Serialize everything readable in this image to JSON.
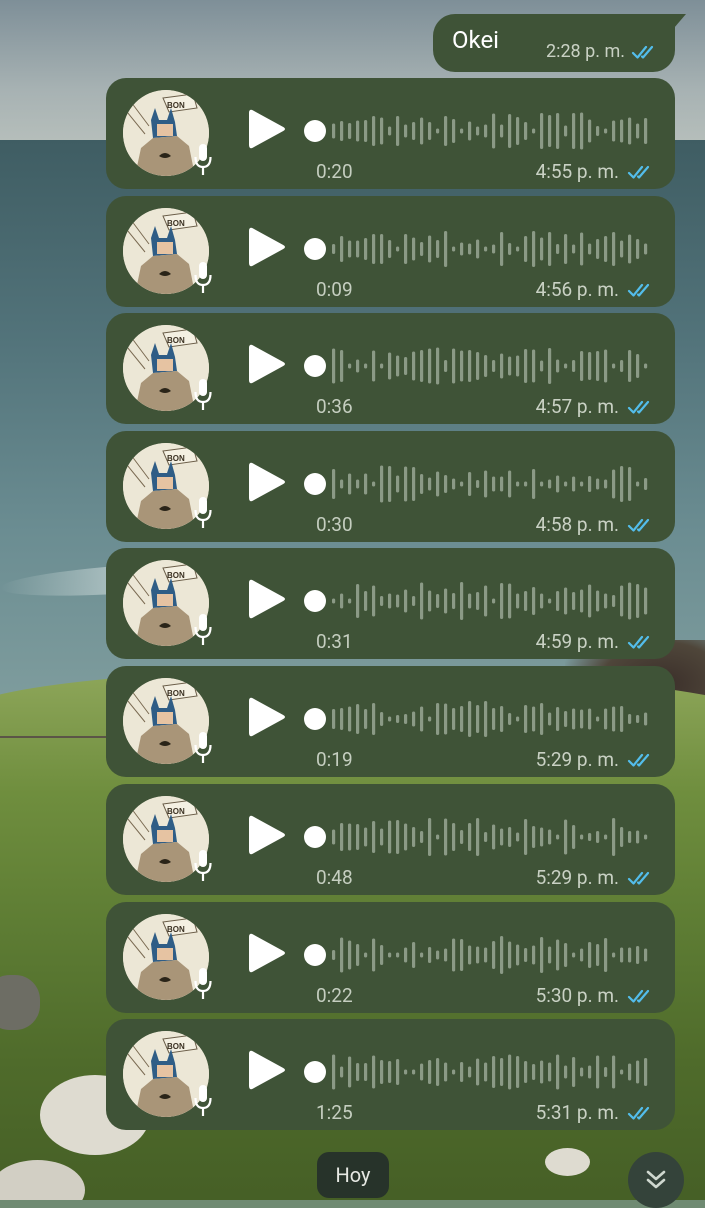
{
  "chat": {
    "text_message": {
      "text": "Okei",
      "time": "2:28 p. m.",
      "status": "read"
    },
    "voice_messages": [
      {
        "duration": "0:20",
        "time": "4:55 p. m."
      },
      {
        "duration": "0:09",
        "time": "4:56 p. m."
      },
      {
        "duration": "0:36",
        "time": "4:57 p. m."
      },
      {
        "duration": "0:30",
        "time": "4:58 p. m."
      },
      {
        "duration": "0:31",
        "time": "4:59 p. m."
      },
      {
        "duration": "0:19",
        "time": "5:29 p. m."
      },
      {
        "duration": "0:48",
        "time": "5:29 p. m."
      },
      {
        "duration": "0:22",
        "time": "5:30 p. m."
      },
      {
        "duration": "1:25",
        "time": "5:31 p. m."
      }
    ],
    "date_label": "Hoy"
  },
  "icons": {
    "play": "play-icon",
    "mic": "mic-icon",
    "read_ticks": "double-check-icon",
    "scroll": "double-chevron-down-icon"
  },
  "colors": {
    "bubble": "#3f5337",
    "tick": "#53bdeb",
    "waveform": "#8b9a86",
    "meta_text": "#c9d1c4"
  }
}
